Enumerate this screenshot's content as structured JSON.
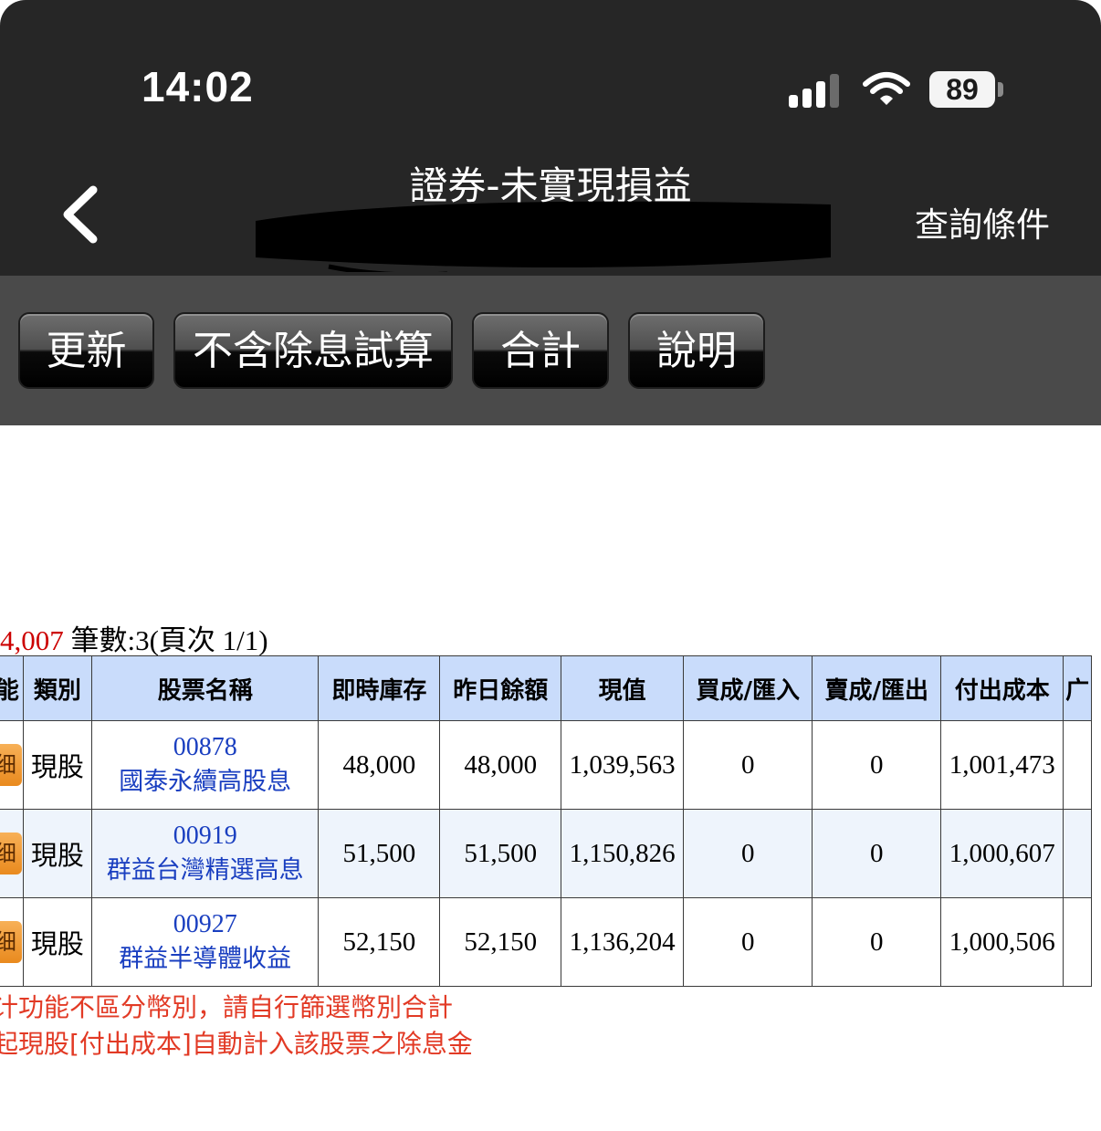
{
  "status": {
    "time": "14:02",
    "battery": "89"
  },
  "nav": {
    "title": "證券-未實現損益",
    "query_label": "查詢條件"
  },
  "toolbar": {
    "buttons": [
      "更新",
      "不含除息試算",
      "合計",
      "說明"
    ]
  },
  "summary": {
    "amount_fragment": "4,007",
    "count_text": " 筆數:3(頁次 1/1)"
  },
  "table": {
    "headers": [
      "能",
      "類別",
      "股票名稱",
      "即時庫存",
      "昨日餘額",
      "現值",
      "買成/匯入",
      "賣成/匯出",
      "付出成本",
      "广"
    ],
    "detail_label": "细",
    "rows": [
      {
        "type": "現股",
        "code": "00878",
        "name": "國泰永續高股息",
        "realtime": "48,000",
        "yesterday": "48,000",
        "value": "1,039,563",
        "buy": "0",
        "sell": "0",
        "cost": "1,001,473"
      },
      {
        "type": "現股",
        "code": "00919",
        "name": "群益台灣精選高息",
        "realtime": "51,500",
        "yesterday": "51,500",
        "value": "1,150,826",
        "buy": "0",
        "sell": "0",
        "cost": "1,000,607"
      },
      {
        "type": "現股",
        "code": "00927",
        "name": "群益半導體收益",
        "realtime": "52,150",
        "yesterday": "52,150",
        "value": "1,136,204",
        "buy": "0",
        "sell": "0",
        "cost": "1,000,506"
      }
    ]
  },
  "notes": [
    "计功能不區分幣別，請自行篩選幣別合計",
    "起現股[付出成本]自動計入該股票之除息金"
  ]
}
